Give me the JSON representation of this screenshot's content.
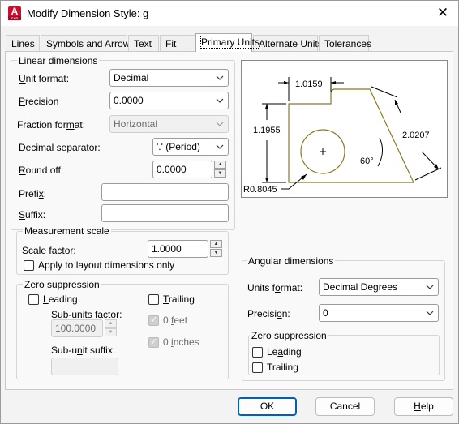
{
  "window": {
    "title": "Modify Dimension Style: g",
    "close_glyph": "✕",
    "app_icon_letter": "A",
    "app_icon_sub": "CAD"
  },
  "tabs": [
    {
      "label": "Lines"
    },
    {
      "label": "Symbols and Arrows"
    },
    {
      "label": "Text"
    },
    {
      "label": "Fit"
    },
    {
      "label": "Primary Units"
    },
    {
      "label": "Alternate Units"
    },
    {
      "label": "Tolerances"
    }
  ],
  "active_tab": "Primary Units",
  "linear": {
    "title": "Linear dimensions",
    "unit_format": {
      "label_pre": "",
      "label_u": "U",
      "label_post": "nit format:",
      "value": "Decimal"
    },
    "precision": {
      "label_pre": "",
      "label_u": "P",
      "label_post": "recision",
      "value": "0.0000"
    },
    "fraction_format": {
      "label_pre": "Fraction for",
      "label_u": "m",
      "label_post": "at:",
      "value": "Horizontal"
    },
    "decimal_separator": {
      "label_pre": "De",
      "label_u": "c",
      "label_post": "imal separator:",
      "value": "'.' (Period)"
    },
    "round_off": {
      "label_pre": "",
      "label_u": "R",
      "label_post": "ound off:",
      "value": "0.0000"
    },
    "prefix": {
      "label_pre": "Prefi",
      "label_u": "x",
      "label_post": ":",
      "value": ""
    },
    "suffix": {
      "label_pre": "",
      "label_u": "S",
      "label_post": "uffix:",
      "value": ""
    }
  },
  "measurement": {
    "title": "Measurement scale",
    "scale_factor": {
      "label_pre": "Scal",
      "label_u": "e",
      "label_post": " factor:",
      "value": "1.0000"
    },
    "apply_layout": {
      "label": "Apply to layout dimensions only",
      "checked": false
    }
  },
  "zero_linear": {
    "title": "Zero suppression",
    "leading": {
      "label_pre": "",
      "label_u": "L",
      "label_post": "eading",
      "checked": false
    },
    "trailing": {
      "label_pre": "",
      "label_u": "T",
      "label_post": "railing",
      "checked": false
    },
    "sub_units_factor": {
      "label_pre": "Su",
      "label_u": "b",
      "label_post": "-units factor:",
      "value": "100.0000"
    },
    "feet": {
      "label_pre": "0 ",
      "label_u": "f",
      "label_post": "eet",
      "checked": true
    },
    "sub_unit_suffix": {
      "label_pre": "Sub-u",
      "label_u": "n",
      "label_post": "it suffix:",
      "value": ""
    },
    "inches": {
      "label_pre": "0 ",
      "label_u": "i",
      "label_post": "nches",
      "checked": true
    }
  },
  "preview": {
    "dim_top": "1.0159",
    "dim_left": "1.1955",
    "dim_right": "2.0207",
    "dim_angle": "60°",
    "dim_radius": "R0.8045",
    "outline_color": "#8b7a1f"
  },
  "angular": {
    "title": "Angular dimensions",
    "units_format": {
      "label_pre": "Units f",
      "label_u": "o",
      "label_post": "rmat:",
      "value": "Decimal Degrees"
    },
    "precision": {
      "label_pre": "Precisi",
      "label_u": "o",
      "label_post": "n:",
      "value": "0"
    },
    "zero_title": "Zero suppression",
    "leading": {
      "label_pre": "Le",
      "label_u": "a",
      "label_post": "ding",
      "checked": false
    },
    "trailing": {
      "label_pre": "Trailin",
      "label_u": "g",
      "label_post": "",
      "checked": false
    }
  },
  "buttons": {
    "ok": "OK",
    "cancel": "Cancel",
    "help_pre": "",
    "help_u": "H",
    "help_post": "elp"
  },
  "colors": {
    "accent": "#005fb8",
    "app_icon": "#c8102e"
  }
}
